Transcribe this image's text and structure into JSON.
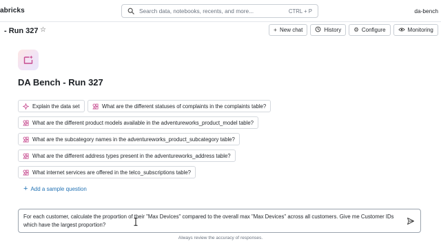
{
  "topbar": {
    "brand": "abricks",
    "search_placeholder": "Search data, notebooks, recents, and more...",
    "search_shortcut": "CTRL + P",
    "workspace": "da-bench"
  },
  "header": {
    "title": "- Run 327",
    "buttons": {
      "new_chat": "New chat",
      "history": "History",
      "configure": "Configure",
      "monitoring": "Monitoring"
    }
  },
  "space": {
    "title": "DA Bench - Run 327"
  },
  "suggestions": {
    "explain": "Explain the data set",
    "q1": "What are the different statuses of complaints in the complaints table?",
    "q2": "What are the different product models available in the adventureworks_product_model table?",
    "q3": "What are the subcategory names in the adventureworks_product_subcategory table?",
    "q4": "What are the different address types present in the adventureworks_address table?",
    "q5": "What internet services are offered in the telco_subscriptions table?"
  },
  "add_sample": "Add a sample question",
  "composer": {
    "text": "For each customer, calculate the proportion of their \"Max Devices\" compared to the overall max \"Max Devices\" across all customers. Give me Customer IDs which have the largest proportion?"
  },
  "disclaimer": "Always review the accuracy of responses.",
  "colors": {
    "accent_link": "#2272b4",
    "genie_magenta": "#c64a8f",
    "border": "#c9ced4"
  },
  "icons": {
    "search": "search-icon",
    "star": "star-icon",
    "plus": "plus-icon",
    "history": "history-icon",
    "configure": "gear-icon",
    "monitoring": "eye-icon",
    "sparkle": "sparkle-icon",
    "sample": "shapes-icon",
    "send": "send-icon"
  }
}
